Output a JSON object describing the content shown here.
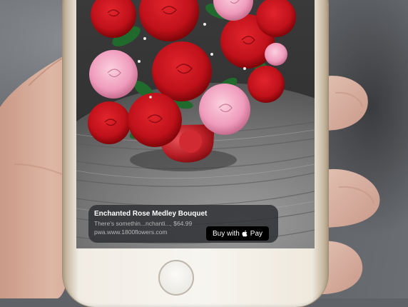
{
  "banner": {
    "title": "Enchanted Rose Medley Bouquet",
    "subtitle": "There's somethin...nchanti..., $64.99",
    "url": "pwa.www.1800flowers.com",
    "pay_button_label_prefix": "Buy with",
    "pay_button_label_suffix": "Pay"
  },
  "colors": {
    "banner_bg": "#303134",
    "pay_button_bg": "#000000",
    "rose_red": "#c8141d",
    "rose_pink": "#f2a2bf",
    "phone_body": "#f5f3ee"
  },
  "icons": {
    "apple_logo": "apple-icon",
    "home_button": "home-button-icon"
  }
}
